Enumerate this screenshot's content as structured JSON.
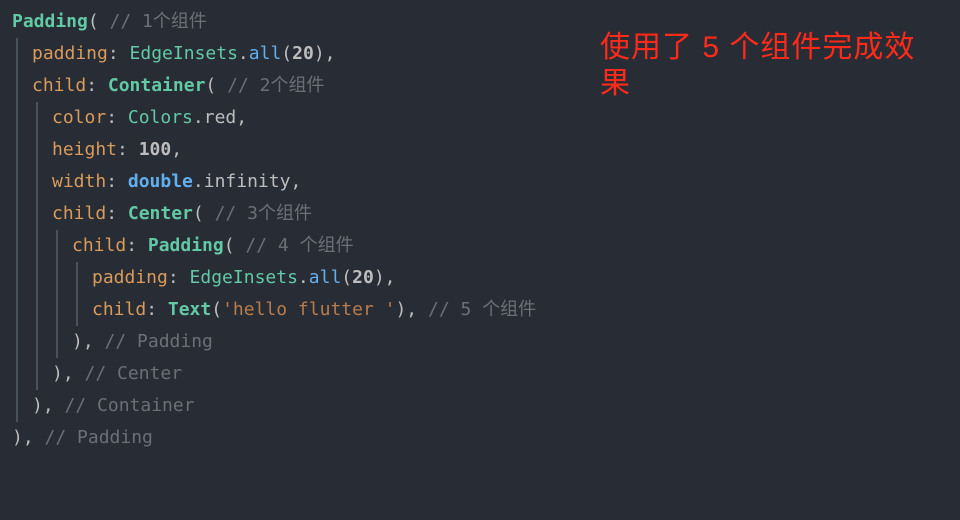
{
  "annotation": {
    "text": "使用了 5 个组件完成效果"
  },
  "code": {
    "lines": [
      {
        "indent": 0,
        "segments": [
          {
            "cls": "tok-class bold",
            "t": "Padding"
          },
          {
            "cls": "tok-punct",
            "t": "( "
          },
          {
            "cls": "tok-comment",
            "t": "// 1个组件"
          }
        ]
      },
      {
        "indent": 1,
        "segments": [
          {
            "cls": "tok-param",
            "t": "padding"
          },
          {
            "cls": "tok-punct",
            "t": ": "
          },
          {
            "cls": "tok-type",
            "t": "EdgeInsets"
          },
          {
            "cls": "tok-punct",
            "t": "."
          },
          {
            "cls": "tok-func",
            "t": "all"
          },
          {
            "cls": "tok-punct",
            "t": "("
          },
          {
            "cls": "tok-num",
            "t": "20"
          },
          {
            "cls": "tok-punct",
            "t": "),"
          }
        ]
      },
      {
        "indent": 1,
        "segments": [
          {
            "cls": "tok-param",
            "t": "child"
          },
          {
            "cls": "tok-punct",
            "t": ": "
          },
          {
            "cls": "tok-class bold",
            "t": "Container"
          },
          {
            "cls": "tok-punct",
            "t": "( "
          },
          {
            "cls": "tok-comment",
            "t": "// 2个组件"
          }
        ]
      },
      {
        "indent": 2,
        "segments": [
          {
            "cls": "tok-param",
            "t": "color"
          },
          {
            "cls": "tok-punct",
            "t": ": "
          },
          {
            "cls": "tok-type",
            "t": "Colors"
          },
          {
            "cls": "tok-punct",
            "t": "."
          },
          {
            "cls": "tok-prop",
            "t": "red"
          },
          {
            "cls": "tok-punct",
            "t": ","
          }
        ]
      },
      {
        "indent": 2,
        "segments": [
          {
            "cls": "tok-param",
            "t": "height"
          },
          {
            "cls": "tok-punct",
            "t": ": "
          },
          {
            "cls": "tok-num bold",
            "t": "100"
          },
          {
            "cls": "tok-punct",
            "t": ","
          }
        ]
      },
      {
        "indent": 2,
        "segments": [
          {
            "cls": "tok-param",
            "t": "width"
          },
          {
            "cls": "tok-punct",
            "t": ": "
          },
          {
            "cls": "tok-kw bold",
            "t": "double"
          },
          {
            "cls": "tok-punct",
            "t": "."
          },
          {
            "cls": "tok-prop",
            "t": "infinity"
          },
          {
            "cls": "tok-punct",
            "t": ","
          }
        ]
      },
      {
        "indent": 2,
        "segments": [
          {
            "cls": "tok-param",
            "t": "child"
          },
          {
            "cls": "tok-punct",
            "t": ": "
          },
          {
            "cls": "tok-class bold",
            "t": "Center"
          },
          {
            "cls": "tok-punct",
            "t": "( "
          },
          {
            "cls": "tok-comment",
            "t": "// 3个组件"
          }
        ]
      },
      {
        "indent": 3,
        "segments": [
          {
            "cls": "tok-param",
            "t": "child"
          },
          {
            "cls": "tok-punct",
            "t": ": "
          },
          {
            "cls": "tok-class bold",
            "t": "Padding"
          },
          {
            "cls": "tok-punct",
            "t": "( "
          },
          {
            "cls": "tok-comment",
            "t": "// 4 个组件"
          }
        ]
      },
      {
        "indent": 4,
        "segments": [
          {
            "cls": "tok-param",
            "t": "padding"
          },
          {
            "cls": "tok-punct",
            "t": ": "
          },
          {
            "cls": "tok-type",
            "t": "EdgeInsets"
          },
          {
            "cls": "tok-punct",
            "t": "."
          },
          {
            "cls": "tok-func",
            "t": "all"
          },
          {
            "cls": "tok-punct",
            "t": "("
          },
          {
            "cls": "tok-num",
            "t": "20"
          },
          {
            "cls": "tok-punct",
            "t": "),"
          }
        ]
      },
      {
        "indent": 4,
        "segments": [
          {
            "cls": "tok-param",
            "t": "child"
          },
          {
            "cls": "tok-punct",
            "t": ": "
          },
          {
            "cls": "tok-class bold",
            "t": "Text"
          },
          {
            "cls": "tok-punct",
            "t": "("
          },
          {
            "cls": "tok-str",
            "t": "'hello flutter '"
          },
          {
            "cls": "tok-punct",
            "t": "), "
          },
          {
            "cls": "tok-comment",
            "t": "// 5 个组件"
          }
        ]
      },
      {
        "indent": 3,
        "segments": [
          {
            "cls": "tok-punct",
            "t": "), "
          },
          {
            "cls": "tok-comment",
            "t": "// Padding"
          }
        ]
      },
      {
        "indent": 2,
        "segments": [
          {
            "cls": "tok-punct",
            "t": "), "
          },
          {
            "cls": "tok-comment",
            "t": "// Center"
          }
        ]
      },
      {
        "indent": 1,
        "segments": [
          {
            "cls": "tok-punct",
            "t": "), "
          },
          {
            "cls": "tok-comment",
            "t": "// Container"
          }
        ]
      },
      {
        "indent": 0,
        "segments": [
          {
            "cls": "tok-punct",
            "t": "), "
          },
          {
            "cls": "tok-comment",
            "t": "// Padding"
          }
        ]
      }
    ]
  }
}
